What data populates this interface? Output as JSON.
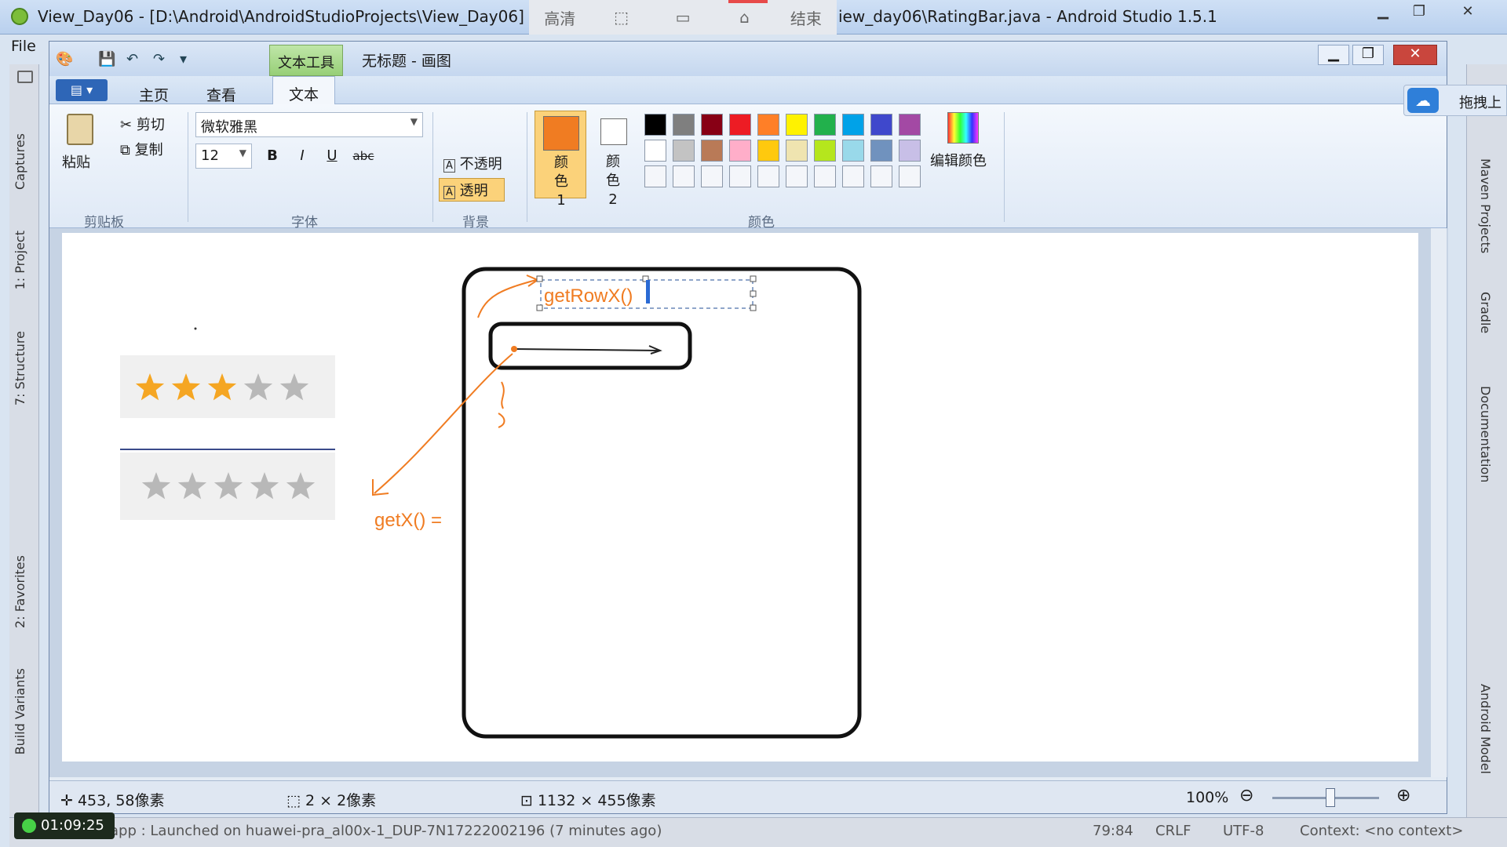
{
  "android_studio": {
    "title_left": "View_Day06 - [D:\\Android\\AndroidStudioProjects\\View_Day06] - [a",
    "title_right": "iew_day06\\RatingBar.java - Android Studio 1.5.1",
    "menu_file": "File",
    "left_tabs": [
      "Captures",
      "1: Project",
      "7: Structure",
      "2: Favorites",
      "Build Variants"
    ],
    "right_tabs": [
      "Maven Projects",
      "Gradle",
      "Documentation",
      "Android Model"
    ],
    "status_text": "app : Launched on huawei-pra_al00x-1_DUP-7N17222002196 (7 minutes ago)",
    "status_right": [
      "79:84",
      "CRLF",
      "UTF-8",
      "Context: <no context>"
    ],
    "timer": "01:09:25"
  },
  "recording_bar": {
    "items": [
      "高清",
      "结束"
    ]
  },
  "paint": {
    "ctx_tab": "文本工具",
    "doc_title": "无标题 - 画图",
    "tabs": [
      "主页",
      "查看",
      "文本"
    ],
    "clipboard": {
      "paste": "粘贴",
      "cut": "剪切",
      "copy": "复制",
      "label": "剪贴板"
    },
    "font": {
      "family": "微软雅黑",
      "size": "12",
      "label": "字体",
      "bold": "B",
      "italic": "I",
      "underline": "U",
      "strike": "abc"
    },
    "background": {
      "opaque": "不透明",
      "transparent": "透明",
      "label": "背景"
    },
    "colors": {
      "color1_label": "颜色 1",
      "color2_label": "颜色 2",
      "edit_label": "编辑颜色",
      "label": "颜色",
      "color1": "#f07c22",
      "color2": "#ffffff",
      "palette_row1": [
        "#000000",
        "#7f7f7f",
        "#880015",
        "#ed1c24",
        "#ff7f27",
        "#fff200",
        "#22b14c",
        "#00a2e8",
        "#3f48cc",
        "#a349a4"
      ],
      "palette_row2": [
        "#ffffff",
        "#c3c3c3",
        "#b97a57",
        "#ffaec9",
        "#ffc90e",
        "#efe4b0",
        "#b5e61d",
        "#99d9ea",
        "#7092be",
        "#c8bfe7"
      ]
    },
    "canvas": {
      "text_getrowx": "getRowX()",
      "text_getx": "getX() =",
      "rating_filled": 3,
      "rating_total": 5
    },
    "status": {
      "cursor": "453, 58像素",
      "selection": "2 × 2像素",
      "image_size": "1132 × 455像素",
      "zoom": "100%"
    }
  },
  "baidu": {
    "label": "拖拽上"
  }
}
